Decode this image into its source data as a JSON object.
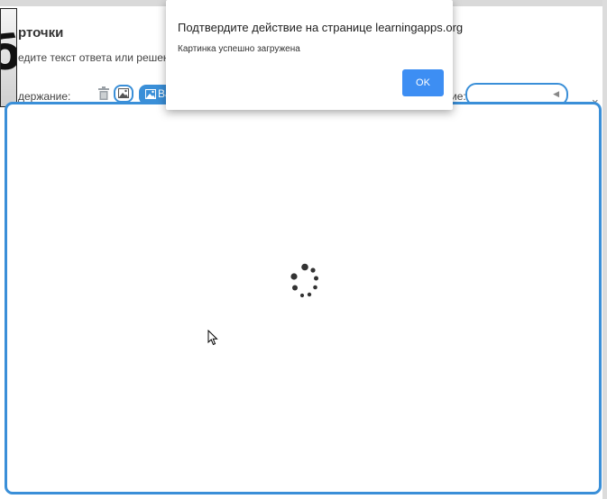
{
  "header": {
    "title": "рточки",
    "hint": "едите текст ответа или решения. Не",
    "content_label": "держание:",
    "image_button_label": "Ва",
    "side_label": "ие:",
    "close_symbol": "×"
  },
  "badge": {
    "text": "б"
  },
  "select": {
    "arrow": "◀"
  },
  "dialog": {
    "title": "Подтвердите действие на странице learningapps.org",
    "message": "Картинка успешно загружена",
    "ok_label": "OK"
  },
  "modal": {
    "state": "loading"
  },
  "colors": {
    "accent": "#3a8fd8",
    "ok_button": "#3d8ef3"
  },
  "icons": [
    "trash-icon",
    "image-icon",
    "spinner-icon",
    "cursor-icon"
  ]
}
